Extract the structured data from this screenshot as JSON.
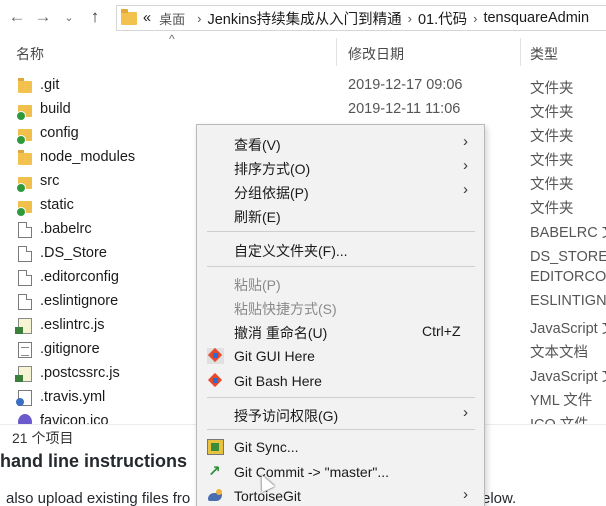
{
  "address_bar": {
    "back_icon": "arrow-left-icon",
    "forward_icon": "arrow-right-icon",
    "up_icon": "arrow-up-icon",
    "breadcrumbs": [
      "«",
      "桌面",
      "Jenkins持续集成从入门到精通",
      "01.代码",
      "tensquareAdmin"
    ]
  },
  "columns": {
    "name": "名称",
    "date": "修改日期",
    "type": "类型"
  },
  "files": [
    {
      "name": ".git",
      "date": "2019-12-17 09:06",
      "type": "文件夹",
      "icon": "folder-icon"
    },
    {
      "name": "build",
      "date": "2019-12-11 11:06",
      "type": "文件夹",
      "icon": "git-folder-icon"
    },
    {
      "name": "config",
      "date": "",
      "type": "文件夹",
      "icon": "git-folder-icon"
    },
    {
      "name": "node_modules",
      "date": "",
      "type": "文件夹",
      "icon": "folder-icon"
    },
    {
      "name": "src",
      "date": "",
      "type": "文件夹",
      "icon": "git-folder-icon"
    },
    {
      "name": "static",
      "date": "",
      "type": "文件夹",
      "icon": "git-folder-icon"
    },
    {
      "name": ".babelrc",
      "date": "",
      "type": "BABELRC 文",
      "icon": "file-icon"
    },
    {
      "name": ".DS_Store",
      "date": "",
      "type": "DS_STORE 文",
      "icon": "file-icon"
    },
    {
      "name": ".editorconfig",
      "date": "",
      "type": "EDITORCON",
      "icon": "file-icon"
    },
    {
      "name": ".eslintignore",
      "date": "",
      "type": "ESLINTIGNC",
      "icon": "file-icon"
    },
    {
      "name": ".eslintrc.js",
      "date": "",
      "type": "JavaScript 文",
      "icon": "js-file-icon"
    },
    {
      "name": ".gitignore",
      "date": "",
      "type": "文本文档",
      "icon": "text-file-icon"
    },
    {
      "name": ".postcssrc.js",
      "date": "",
      "type": "JavaScript 文",
      "icon": "js-file-icon"
    },
    {
      "name": ".travis.yml",
      "date": "",
      "type": "YML 文件",
      "icon": "yml-file-icon"
    },
    {
      "name": "favicon.ico",
      "date": "",
      "type": "ICO 文件",
      "icon": "ico-file-icon"
    }
  ],
  "status_bar": {
    "item_count": "21 个项目"
  },
  "background_page": {
    "heading": "hand line instructions",
    "line_start": "also upload existing files fro",
    "line_end": "elow."
  },
  "context_menu": {
    "view": "查看(V)",
    "sort_by": "排序方式(O)",
    "group_by": "分组依据(P)",
    "refresh": "刷新(E)",
    "customize_folder": "自定义文件夹(F)...",
    "paste": "粘贴(P)",
    "paste_shortcut": "粘贴快捷方式(S)",
    "undo_rename": "撤消 重命名(U)",
    "undo_shortcut": "Ctrl+Z",
    "git_gui_here": "Git GUI Here",
    "git_bash_here": "Git Bash Here",
    "give_access": "授予访问权限(G)",
    "git_sync": "Git Sync...",
    "git_commit": "Git Commit -> \"master\"...",
    "tortoisegit": "TortoiseGit",
    "submenu_arrow": "›"
  }
}
